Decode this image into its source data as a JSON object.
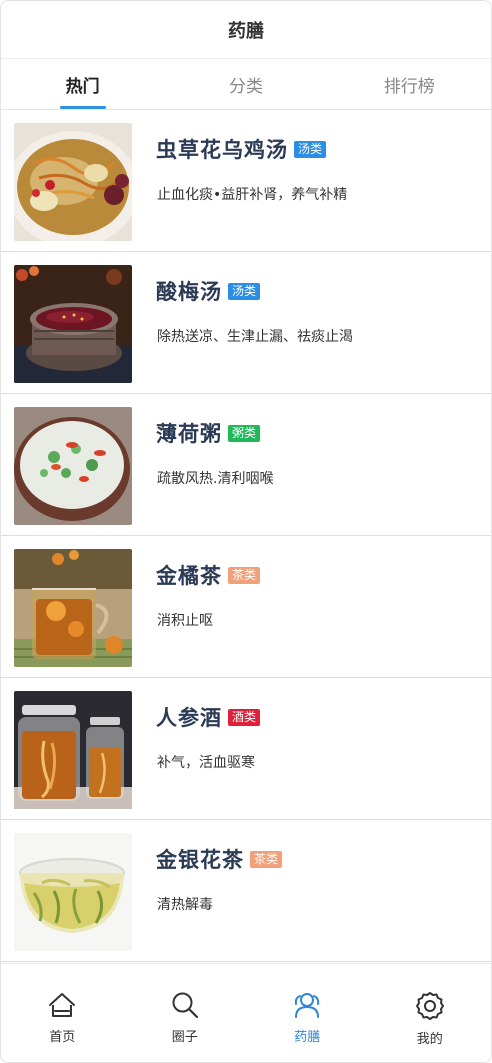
{
  "header": {
    "title": "药膳"
  },
  "tabs": [
    {
      "label": "热门",
      "active": true
    },
    {
      "label": "分类",
      "active": false
    },
    {
      "label": "排行榜",
      "active": false
    }
  ],
  "items": [
    {
      "name": "虫草花乌鸡汤",
      "tag": "汤类",
      "tag_color": "#2a8de6",
      "desc": "止血化痰•益肝补肾，养气补精",
      "image": "cordyceps-chicken-soup"
    },
    {
      "name": "酸梅汤",
      "tag": "汤类",
      "tag_color": "#2a8de6",
      "desc": "除热送凉、生津止漏、祛痰止渴",
      "image": "sour-plum-soup"
    },
    {
      "name": "薄荷粥",
      "tag": "粥类",
      "tag_color": "#1fb85a",
      "desc": "疏散风热.清利咽喉",
      "image": "mint-porridge"
    },
    {
      "name": "金橘茶",
      "tag": "茶类",
      "tag_color": "#f2a07a",
      "desc": "消积止呕",
      "image": "kumquat-tea"
    },
    {
      "name": "人参酒",
      "tag": "酒类",
      "tag_color": "#e0203a",
      "desc": "补气，活血驱寒",
      "image": "ginseng-wine"
    },
    {
      "name": "金银花茶",
      "tag": "茶类",
      "tag_color": "#f2a07a",
      "desc": "清热解毒",
      "image": "honeysuckle-tea"
    }
  ],
  "nav": [
    {
      "label": "首页",
      "icon": "home-icon",
      "active": false
    },
    {
      "label": "圈子",
      "icon": "search-icon",
      "active": false
    },
    {
      "label": "药膳",
      "icon": "users-icon",
      "active": true
    },
    {
      "label": "我的",
      "icon": "gear-icon",
      "active": false
    }
  ],
  "colors": {
    "accent": "#2f8fe0",
    "title_text": "#2b3a55"
  }
}
